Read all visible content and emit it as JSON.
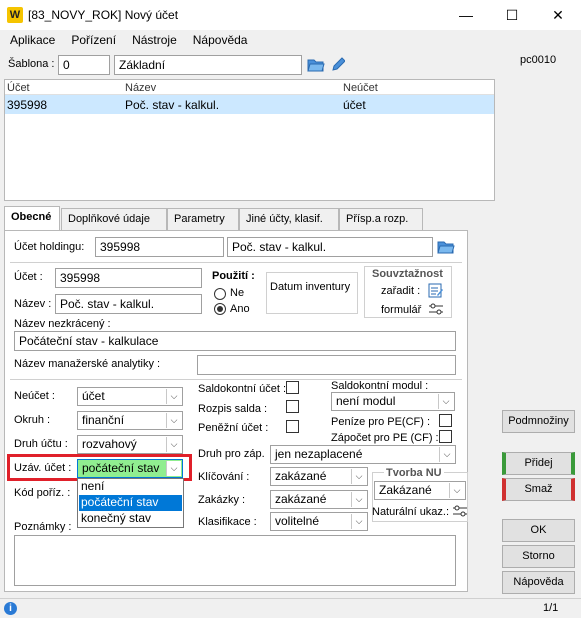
{
  "window": {
    "title": "[83_NOVY_ROK] Nový účet",
    "minimize": "—",
    "maximize": "☐",
    "close": "✕"
  },
  "menu": [
    "Aplikace",
    "Pořízení",
    "Nástroje",
    "Nápověda"
  ],
  "header": {
    "sablona_label": "Šablona :",
    "sablona_value": "0",
    "sablona_name": "Základní",
    "user": "pc0010"
  },
  "grid": {
    "columns": [
      "Účet",
      "Název",
      "Neúčet"
    ],
    "rows": [
      {
        "ucet": "395998",
        "nazev": "Poč. stav - kalkul.",
        "neucet": "účet"
      }
    ]
  },
  "tabs": [
    "Obecné",
    "Doplňkové údaje",
    "Parametry",
    "Jiné účty, klasif.",
    "Přísp.a rozp."
  ],
  "form": {
    "holding_label": "Účet holdingu:",
    "holding_value": "395998",
    "holding_name": "Poč. stav - kalkul.",
    "ucet_label": "Účet :",
    "ucet_value": "395998",
    "nazev_label": "Název :",
    "nazev_value": "Poč. stav - kalkul.",
    "pouziti_label": "Použití :",
    "ne_label": "Ne",
    "ano_label": "Ano",
    "datum_label": "Datum inventury",
    "souvz_title": "Souvztažnost",
    "zaradit_label": "zařadit :",
    "formular_label": "formulář",
    "nazev_nezkr_label": "Název nezkrácený :",
    "nazev_nezkr_value": "Počáteční stav - kalkulace",
    "manaz_label": "Název manažerské analytiky :",
    "neucet_label": "Neúčet :",
    "neucet_value": "účet",
    "okruh_label": "Okruh :",
    "okruh_value": "finanční",
    "druh_label": "Druh účtu :",
    "druh_value": "rozvahový",
    "uzav_label": "Uzáv. účet :",
    "uzav_value": "počáteční stav",
    "uzav_options": [
      "není",
      "počáteční stav",
      "konečný stav"
    ],
    "kod_label": "Kód poříz. :",
    "poznamky_label": "Poznámky :",
    "saldo_ucet_label": "Saldokontní účet :",
    "rozpis_label": "Rozpis salda :",
    "penezni_label": "Peněžní účet :",
    "saldo_modul_label": "Saldokontní modul :",
    "saldo_modul_value": "není modul",
    "penize_pe_label": "Peníze pro PE(CF) :",
    "zapocet_label": "Zápočet pro PE (CF) :",
    "druh_zap_label": "Druh pro záp.",
    "druh_zap_value": "jen nezaplacené",
    "klicovani_label": "Klíčování :",
    "klicovani_value": "zakázané",
    "zakazky_label": "Zakázky :",
    "zakazky_value": "zakázané",
    "klasif_label": "Klasifikace :",
    "klasif_value": "volitelné",
    "tvorba_title": "Tvorba NU",
    "tvorba_value": "Zakázané",
    "naturalni_label": "Naturální ukaz.:"
  },
  "buttons": {
    "podmnoziny": "Podmnožiny",
    "pridej": "Přidej",
    "smaz": "Smaž",
    "ok": "OK",
    "storno": "Storno",
    "napoveda": "Nápověda"
  },
  "status": {
    "info": "i",
    "page": "1/1"
  },
  "colors": {
    "highlight_border": "#e0202a",
    "selected_row": "#cce8ff",
    "combo_selected": "#90ee90",
    "dropdown_selected": "#0078d7",
    "pridej_accent": "#3a9a3a",
    "smaz_accent": "#d03030"
  }
}
